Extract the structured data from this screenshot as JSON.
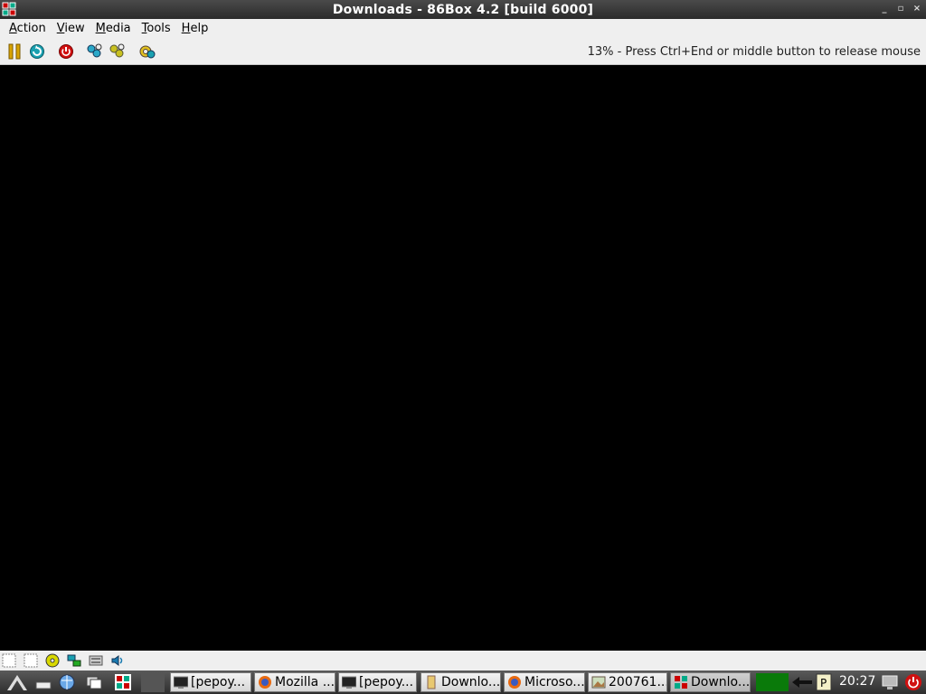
{
  "window": {
    "title": "Downloads - 86Box 4.2 [build 6000]",
    "controls": [
      "minimize-icon",
      "restore-icon",
      "close-icon"
    ]
  },
  "menu": {
    "items": [
      "Action",
      "View",
      "Media",
      "Tools",
      "Help"
    ]
  },
  "toolbar": {
    "buttons": [
      "pause-icon",
      "reset-icon",
      "power-off-icon",
      "ctrl-alt-del-icon",
      "ctrl-alt-esc-icon",
      "settings-icon"
    ],
    "status": "13% - Press Ctrl+End or middle button to release mouse"
  },
  "statusbar": {
    "icons": [
      "floppy-a-icon",
      "floppy-b-icon",
      "cdrom-icon",
      "network-icon",
      "keyboard-icon",
      "sound-icon"
    ]
  },
  "taskbar": {
    "launchers": [
      "start-menu-icon",
      "show-desktop-icon",
      "browser-icon",
      "window-list-icon",
      "86box-icon"
    ],
    "tasks": [
      {
        "label": "[pepoy...",
        "icon": "terminal-icon"
      },
      {
        "label": "Mozilla ...",
        "icon": "firefox-icon"
      },
      {
        "label": "[pepoy...",
        "icon": "terminal-icon"
      },
      {
        "label": "Downlo...",
        "icon": "folder-icon"
      },
      {
        "label": "Microso...",
        "icon": "firefox-icon"
      },
      {
        "label": "200761...",
        "icon": "image-viewer-icon"
      },
      {
        "label": "Downlo...",
        "icon": "86box-icon"
      }
    ],
    "tray": [
      "cpu-monitor-icon",
      "network-tray-icon",
      "clipboard-icon"
    ],
    "clock": "20:27",
    "end_icons": [
      "display-icon",
      "logout-icon"
    ]
  },
  "colors": {
    "screen": "#000000",
    "titlebar": "#2b2b2b",
    "cpu_graph": "#0a7a0a"
  }
}
